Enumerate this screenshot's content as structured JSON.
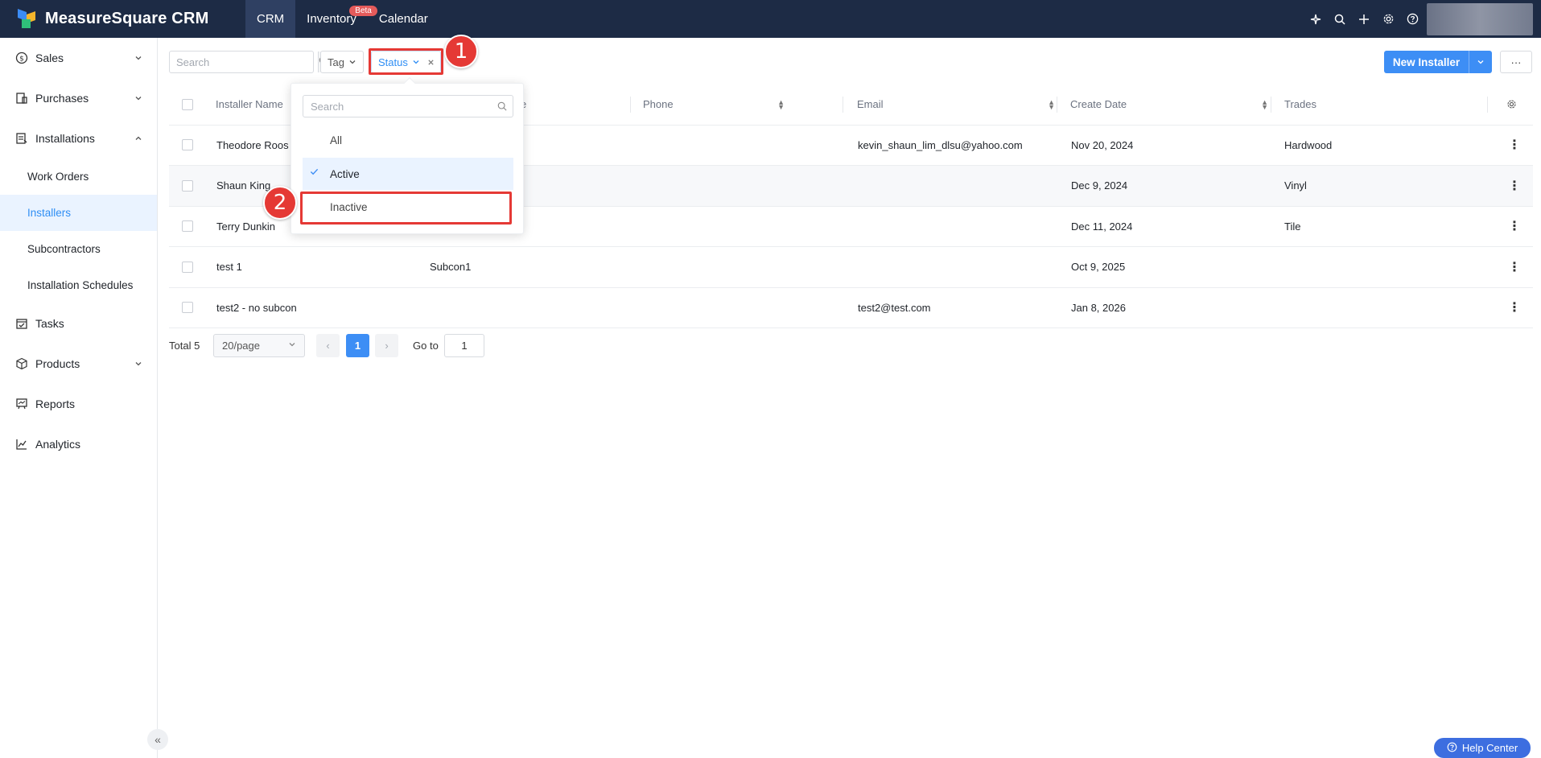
{
  "app": {
    "title": "MeasureSquare CRM"
  },
  "topnav": [
    {
      "label": "CRM",
      "active": true
    },
    {
      "label": "Inventory",
      "badge": "Beta"
    },
    {
      "label": "Calendar"
    }
  ],
  "sidebar": {
    "sales": "Sales",
    "purchases": "Purchases",
    "installations": "Installations",
    "work_orders": "Work Orders",
    "installers": "Installers",
    "subcontractors": "Subcontractors",
    "installation_schedules": "Installation Schedules",
    "tasks": "Tasks",
    "products": "Products",
    "reports": "Reports",
    "analytics": "Analytics"
  },
  "toolbar": {
    "search_placeholder": "Search",
    "tag_label": "Tag",
    "status_label": "Status",
    "new_installer_label": "New Installer",
    "more_label": "···"
  },
  "annotations": {
    "badge_1": "1",
    "badge_2": "2"
  },
  "table": {
    "columns": {
      "installer_name": "Installer Name",
      "subcontractor": "e",
      "phone": "Phone",
      "email": "Email",
      "create_date": "Create Date",
      "trades": "Trades"
    },
    "rows": [
      {
        "name": "Theodore Roos",
        "subcontractor": "",
        "phone": "",
        "email": "kevin_shaun_lim_dlsu@yahoo.com",
        "create_date": "Nov 20, 2024",
        "trades": "Hardwood"
      },
      {
        "name": "Shaun King",
        "subcontractor": "",
        "phone": "",
        "email": "",
        "create_date": "Dec 9, 2024",
        "trades": "Vinyl"
      },
      {
        "name": "Terry Dunkin",
        "subcontractor": "",
        "phone": "",
        "email": "",
        "create_date": "Dec 11, 2024",
        "trades": "Tile"
      },
      {
        "name": "test 1",
        "subcontractor": "Subcon1",
        "phone": "",
        "email": "",
        "create_date": "Oct 9, 2025",
        "trades": ""
      },
      {
        "name": "test2 - no subcon",
        "subcontractor": "",
        "phone": "",
        "email": "test2@test.com",
        "create_date": "Jan 8, 2026",
        "trades": ""
      }
    ]
  },
  "pagination": {
    "total": "Total 5",
    "page_size": "20/page",
    "current_page": "1",
    "goto_label": "Go to",
    "goto_value": "1"
  },
  "status_dropdown": {
    "search_placeholder": "Search",
    "options": [
      {
        "label": "All",
        "selected": false
      },
      {
        "label": "Active",
        "selected": true
      },
      {
        "label": "Inactive",
        "selected": false
      }
    ]
  },
  "help": {
    "label": "Help Center"
  },
  "colors": {
    "topbar": "#1d2b45",
    "accent": "#3d8ef5",
    "annotation": "#e53935"
  }
}
